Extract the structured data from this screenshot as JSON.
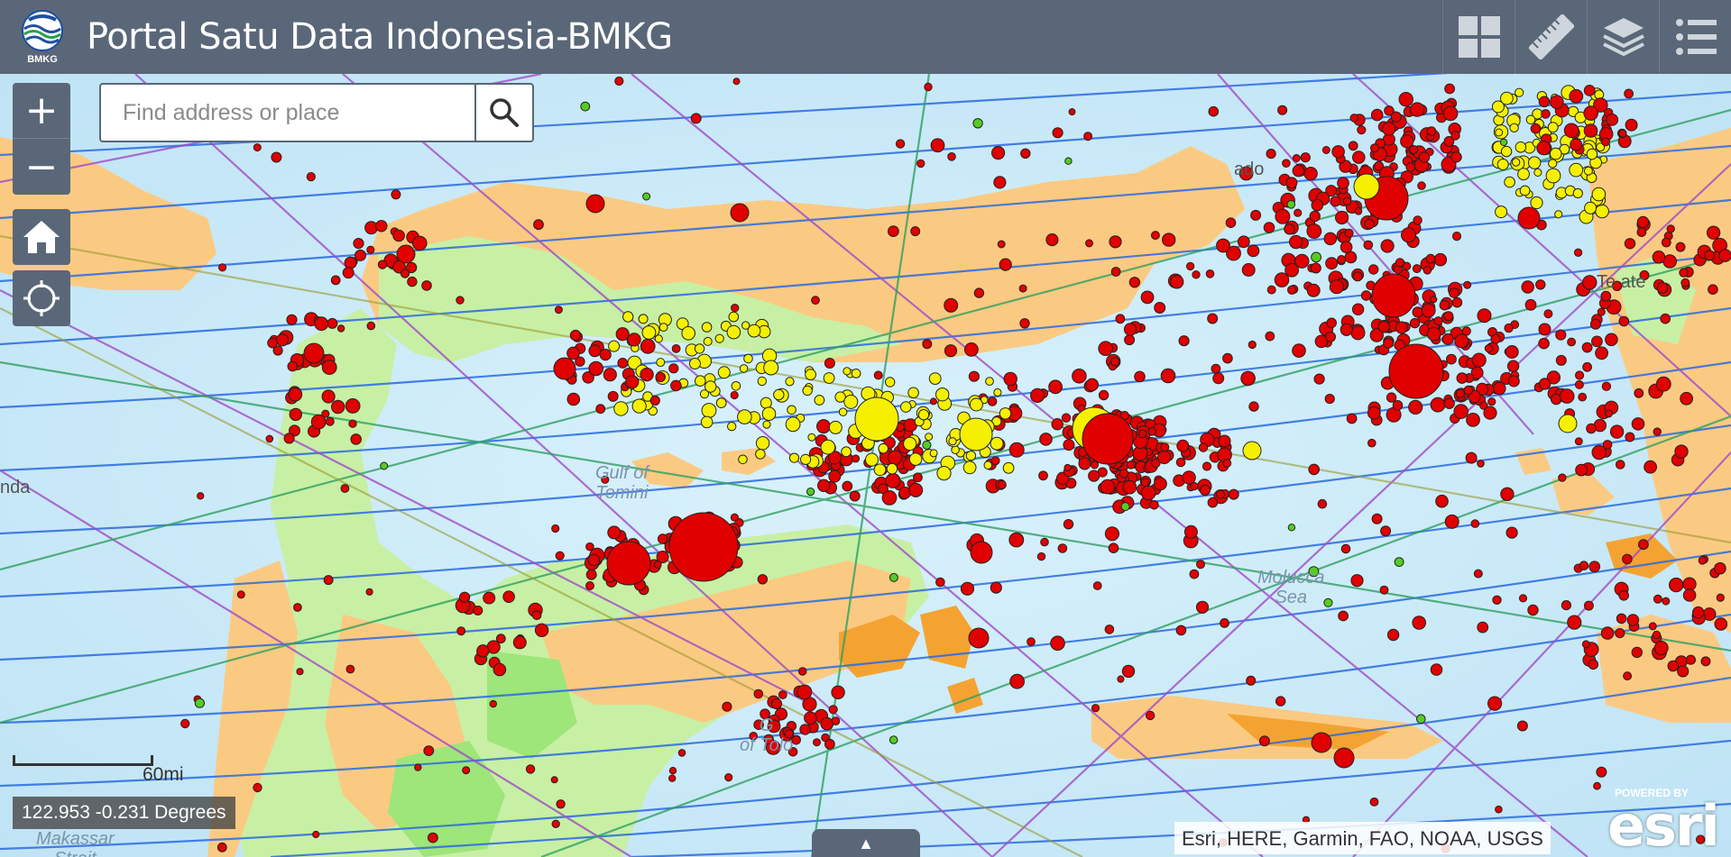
{
  "header": {
    "title": "Portal Satu Data Indonesia-BMKG",
    "logo_text": "BMKG",
    "tools": [
      {
        "name": "basemap-gallery",
        "icon": "grid-icon"
      },
      {
        "name": "measurement",
        "icon": "ruler-icon"
      },
      {
        "name": "layer-list",
        "icon": "layers-icon"
      },
      {
        "name": "legend",
        "icon": "list-icon"
      }
    ]
  },
  "search": {
    "placeholder": "Find address or place",
    "value": ""
  },
  "zoom": {
    "in_label": "+",
    "out_label": "−"
  },
  "scale": {
    "label": "60mi"
  },
  "coordinates": {
    "text": "122.953 -0.231 Degrees"
  },
  "attribution": {
    "text": "Esri, HERE, Garmin, FAO, NOAA, USGS",
    "powered_by": "POWERED BY",
    "brand": "esri"
  },
  "map_labels": {
    "gulf_of_tomini": "Gulf of\nTomini",
    "molucca_sea": "Molucca\nSea",
    "makassar_strait": "Makassar\nStrait",
    "manado": "ado",
    "ternate": "Te   ate",
    "panda": "nda",
    "gulf_of_tolo": "G\nof Tolo"
  },
  "colors": {
    "header_bg": "#5a6778",
    "sea": "#cfeefa",
    "land_orange": "#fbca82",
    "land_green": "#c7f0a4",
    "quake_red": "#e00000",
    "quake_yellow": "#f5f000",
    "quake_green": "#55cc22"
  }
}
